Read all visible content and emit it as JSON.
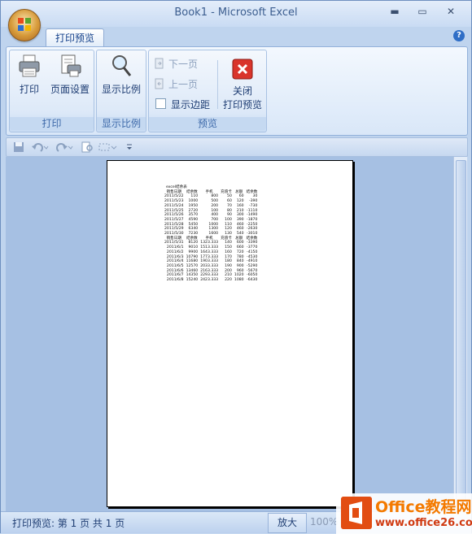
{
  "window": {
    "title": "Book1 - Microsoft Excel",
    "minimize": "▬",
    "maximize": "▭",
    "close": "✕"
  },
  "tab": {
    "label": "打印预览",
    "help": "?"
  },
  "ribbon": {
    "groups": [
      {
        "label": "打印",
        "buttons": [
          "打印",
          "页面设置"
        ]
      },
      {
        "label": "显示比例",
        "buttons": [
          "显示比例"
        ]
      },
      {
        "label": "预览",
        "next_page": "下一页",
        "prev_page": "上一页",
        "show_margins": "显示边距",
        "close_line1": "关闭",
        "close_line2": "打印预览"
      }
    ]
  },
  "qat": {
    "items": [
      "save-icon",
      "undo-icon",
      "redo-icon",
      "print-preview-icon",
      "customize-icon"
    ]
  },
  "sheet": {
    "title": "excel结余表",
    "headers": [
      "销售日期",
      "结余数",
      "手机",
      "充值卡",
      "总额",
      "结余数"
    ],
    "rows": [
      [
        "2011/5/22",
        "110",
        "800",
        "50",
        "60",
        "30"
      ],
      [
        "2011/5/23",
        "1000",
        "500",
        "60",
        "120",
        "-390"
      ],
      [
        "2011/5/24",
        "1950",
        "200",
        "70",
        "160",
        "-730"
      ],
      [
        "2011/5/25",
        "2720",
        "100",
        "80",
        "210",
        "-1110"
      ],
      [
        "2011/5/26",
        "3570",
        "400",
        "90",
        "300",
        "-1490"
      ],
      [
        "2011/5/27",
        "4590",
        "700",
        "100",
        "390",
        "-1870"
      ],
      [
        "2011/5/28",
        "5450",
        "1000",
        "110",
        "460",
        "-2250"
      ],
      [
        "2011/5/29",
        "6340",
        "1300",
        "120",
        "460",
        "-2630"
      ],
      [
        "2011/5/30",
        "7230",
        "1600",
        "130",
        "540",
        "-3010"
      ]
    ],
    "headers2": [
      "销售日期",
      "结余数",
      "手机",
      "充值卡",
      "总额",
      "结余数"
    ],
    "rows2": [
      [
        "2011/5/31",
        "8120",
        "1323.333",
        "140",
        "600",
        "-3390"
      ],
      [
        "2011/6/1",
        "9010",
        "1513.333",
        "150",
        "660",
        "-3770"
      ],
      [
        "2011/6/2",
        "9900",
        "1643.333",
        "160",
        "720",
        "-4150"
      ],
      [
        "2011/6/3",
        "10790",
        "1773.333",
        "170",
        "780",
        "-4530"
      ],
      [
        "2011/6/4",
        "11680",
        "1903.333",
        "180",
        "840",
        "-4910"
      ],
      [
        "2011/6/5",
        "12570",
        "2033.333",
        "190",
        "900",
        "-5290"
      ],
      [
        "2011/6/6",
        "13460",
        "2163.333",
        "200",
        "960",
        "-5670"
      ],
      [
        "2011/6/7",
        "14350",
        "2293.333",
        "210",
        "1020",
        "-6050"
      ],
      [
        "2011/6/8",
        "15240",
        "2423.333",
        "220",
        "1080",
        "-6430"
      ]
    ]
  },
  "status": {
    "text": "打印预览: 第 1 页 共 1 页",
    "zoom_in": "放大",
    "zoom_pct": "100%"
  },
  "watermark": {
    "line1": "Office教程网",
    "line2": "www.office26.com"
  }
}
